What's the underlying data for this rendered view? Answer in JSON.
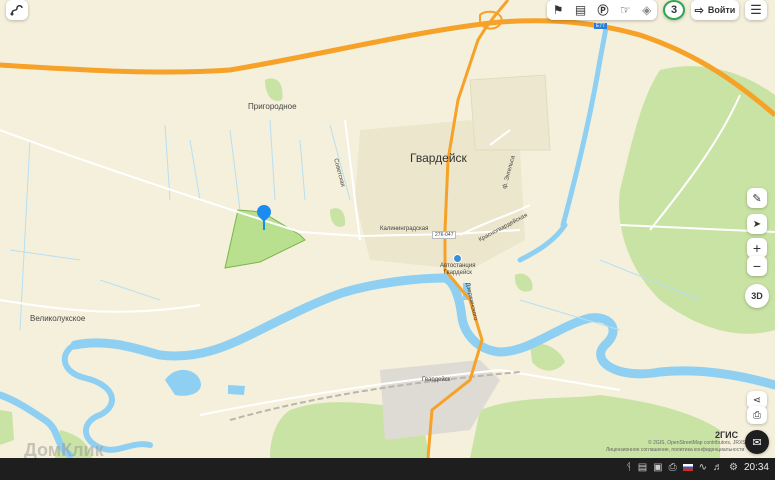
{
  "map": {
    "labels": {
      "town": "Гвардейск",
      "village_north": "Пригородное",
      "village_west": "Великолукское",
      "street_kaliningradskaya": "Калининградская",
      "street_sovetskaya": "Советская",
      "street_krasnogvardeyskaya": "Красногвардейская",
      "street_engelsa": "ф. Энгельса",
      "street_dzerzhinskogo": "Дзержинского",
      "road_27k": "27К-047",
      "road_a": "Е77",
      "bus_station_line1": "Автостанция",
      "bus_station_line2": "Гвардейск",
      "station": "Гвардейск",
      "brand": "2ГИС",
      "copyright": "© 2GIS, OpenStreetMap contributors, JRXS",
      "legal": "Лицензионное соглашение, политика конфиденциальности",
      "watermark": "ДомКлик"
    }
  },
  "toolbar": {
    "icons": [
      "traffic-icon",
      "transport-icon",
      "parking-icon",
      "road-sign-icon",
      "layers-icon"
    ],
    "weather_value": "3",
    "login_label": "Войти"
  },
  "controls": {
    "zoom_in": "+",
    "zoom_out": "−",
    "view_3d": "3D"
  },
  "taskbar": {
    "time": "20:34"
  },
  "colors": {
    "land": "#f5f0dc",
    "forest": "#c9e3a4",
    "water": "#8fd0f2",
    "road_major": "#f6a128",
    "pin": "#1b8bf0",
    "weather_ring": "#2fa84f"
  }
}
